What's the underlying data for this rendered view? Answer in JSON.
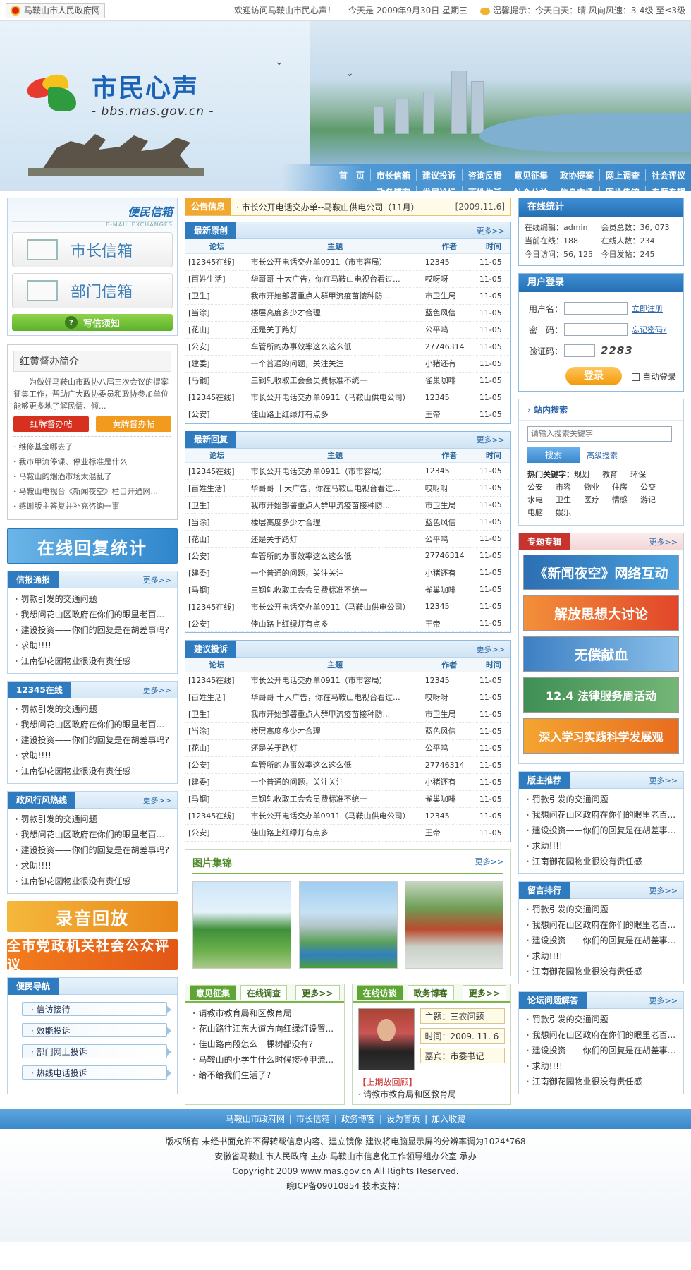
{
  "topbar": {
    "site_name": "马鞍山市人民政府网",
    "welcome": "欢迎访问马鞍山市民心声！",
    "date": "今天是 2009年9月30日 星期三",
    "weather": "温馨提示：今天白天：晴 风向风速：3-4级 至≤3级"
  },
  "header": {
    "title": "市民心声",
    "subtitle": "- bbs.mas.gov.cn -",
    "nav_row1": [
      "首　页",
      "市长信箱",
      "建议投诉",
      "咨询反馈",
      "意见征集",
      "政协提案",
      "网上调查",
      "社会评议"
    ],
    "nav_row2": [
      "政务博客",
      "发展论坛",
      "百姓生活",
      "社会公益",
      "信息市场",
      "图片集锦",
      "专题专辑"
    ]
  },
  "left": {
    "letters_title": "便民信箱",
    "letters_sub": "E-MAIL EXCHANGES",
    "mayor_box": "市长信箱",
    "dept_box": "部门信箱",
    "write_notice": "写信须知",
    "intro_title": "红黄督办简介",
    "intro_text": "为做好马鞍山市政协八届三次会议的提案征集工作，帮助广大政协委员和政协参加单位能够更多地了解民情、倾...",
    "red_btn": "红牌督办帖",
    "yellow_btn": "黄牌督办帖",
    "intro_items": [
      "维修基金哪去了",
      "我市甲流停课、停业标准是什么",
      "马鞍山的烟酒市场太混乱了",
      "马鞍山电视台《新闻夜空》栏目开通网...",
      "感谢版主答复并补充咨询一事"
    ],
    "reply_banner": "在线回复统计",
    "box1_title": "信报通报",
    "box2_title": "12345在线",
    "box3_title": "政风行风热线",
    "more": "更多>>",
    "common_items": [
      "罚款引发的交通问题",
      "我想问花山区政府在你们的眼里老百...",
      "建设投资——你们的回复是在胡差事吗?",
      "求助!!!!",
      "江南御花园物业很没有责任感"
    ],
    "record_banner": "录音回放",
    "eval_banner": "全市党政机关社会公众评议",
    "convenience_title": "便民导航",
    "convenience_links": [
      "信访接待",
      "效能投诉",
      "部门网上投诉",
      "热线电话投诉"
    ]
  },
  "middle": {
    "notice_label": "公告信息",
    "notice_text": "· 市长公开电话交办单--马鞍山供电公司（11月）",
    "notice_date": "[2009.11.6]",
    "headers": [
      "论坛",
      "主题",
      "作者",
      "时间"
    ],
    "sections": [
      {
        "title": "最新原创",
        "more": "更多>>"
      },
      {
        "title": "最新回复",
        "more": "更多>>"
      },
      {
        "title": "建议投诉",
        "more": "更多>>"
      }
    ],
    "rows": [
      [
        "[12345在线]",
        "市长公开电话交办单0911（市市容局）",
        "12345",
        "11-05"
      ],
      [
        "[百姓生活]",
        "华哥哥 十大广告，你在马鞍山电视台看过...",
        "哎呀呀",
        "11-05"
      ],
      [
        "[卫生]",
        "我市开始部署重点人群甲流疫苗接种防...",
        "市卫生局",
        "11-05"
      ],
      [
        "[当涂]",
        "楼层高度多少才合理",
        "蓝色风信",
        "11-05"
      ],
      [
        "[花山]",
        "还是关于路灯",
        "公平鸣",
        "11-05"
      ],
      [
        "[公安]",
        "车管所的办事效率这么这么低",
        "27746314",
        "11-05"
      ],
      [
        "[建委]",
        "一个普通的问题，关注关注",
        "小猪还有",
        "11-05"
      ],
      [
        "[马钢]",
        "三钢轧收取工会会员费标准不统一",
        "雀巢咖啡",
        "11-05"
      ],
      [
        "[12345在线]",
        "市长公开电话交办单0911（马鞍山供电公司）",
        "12345",
        "11-05"
      ],
      [
        "[公安]",
        "佳山路上红绿灯有点多",
        "王帝",
        "11-05"
      ]
    ],
    "photos_title": "图片集锦",
    "photos_more": "更多>>",
    "opinion_tab": "意见征集",
    "survey_tab": "在线调查",
    "opinion_items": [
      "请教市教育局和区教育局",
      "花山路往江东大道方向红绿灯设置...",
      "佳山路南段怎么一棵树都没有?",
      "马鞍山的小学生什么时候接种甲流...",
      "给不给我们生活了?"
    ],
    "interview_tab": "在线访谈",
    "blog_tab": "政务博客",
    "interview_topic": "主题：三农问题",
    "interview_time": "时间：2009. 11. 6",
    "interview_guest": "嘉宾：市委书记",
    "prev_label": "【上期故回顾】",
    "prev_item": "请教市教育局和区教育局"
  },
  "right": {
    "stat_title": "在线统计",
    "stats": [
      "在线编辑：admin",
      "会员总数：36, 073",
      "当前在线：188",
      "在线人数：234",
      "今日访问：56, 125",
      "今日发帖：245"
    ],
    "login_title": "用户登录",
    "username_label": "用户名：",
    "password_label": "密　码：",
    "code_label": "验证码：",
    "register_link": "立即注册",
    "forgot_link": "忘记密码?",
    "code_value": "2283",
    "login_btn": "登录",
    "auto_login": "自动登录",
    "search_title": "站内搜索",
    "search_placeholder": "请输入搜索关键字",
    "search_btn": "搜索",
    "adv_search": "高级搜索",
    "hot_label": "热门关键字：",
    "hot_words": [
      "规划",
      "教育",
      "环保",
      "公安",
      "市容",
      "物业",
      "住房",
      "公交",
      "水电",
      "卫生",
      "医疗",
      "情感",
      "游记",
      "电脑",
      "娱乐"
    ],
    "special_title": "专题专辑",
    "special_banners": [
      "《新闻夜空》网络互动",
      "解放思想大讨论",
      "无偿献血",
      "12.4 法律服务周活动",
      "深入学习实践科学发展观"
    ],
    "rec_title": "版主推荐",
    "rank_title": "留言排行",
    "qa_title": "论坛问题解答",
    "more": "更多>>"
  },
  "footer": {
    "links": [
      "马鞍山市政府网",
      "市长信箱",
      "政务博客",
      "设为首页",
      "加入收藏"
    ],
    "line1": "版权所有 未经书面允许不得转载信息内容、建立镜像 建议将电脑显示屏的分辨率调为1024*768",
    "line2": "安徽省马鞍山市人民政府 主办 马鞍山市信息化工作领导组办公室 承办",
    "line3": "Copyright 2009 www.mas.gov.cn All Rights Reserved.",
    "line4": "皖ICP备09010854 技术支持："
  }
}
